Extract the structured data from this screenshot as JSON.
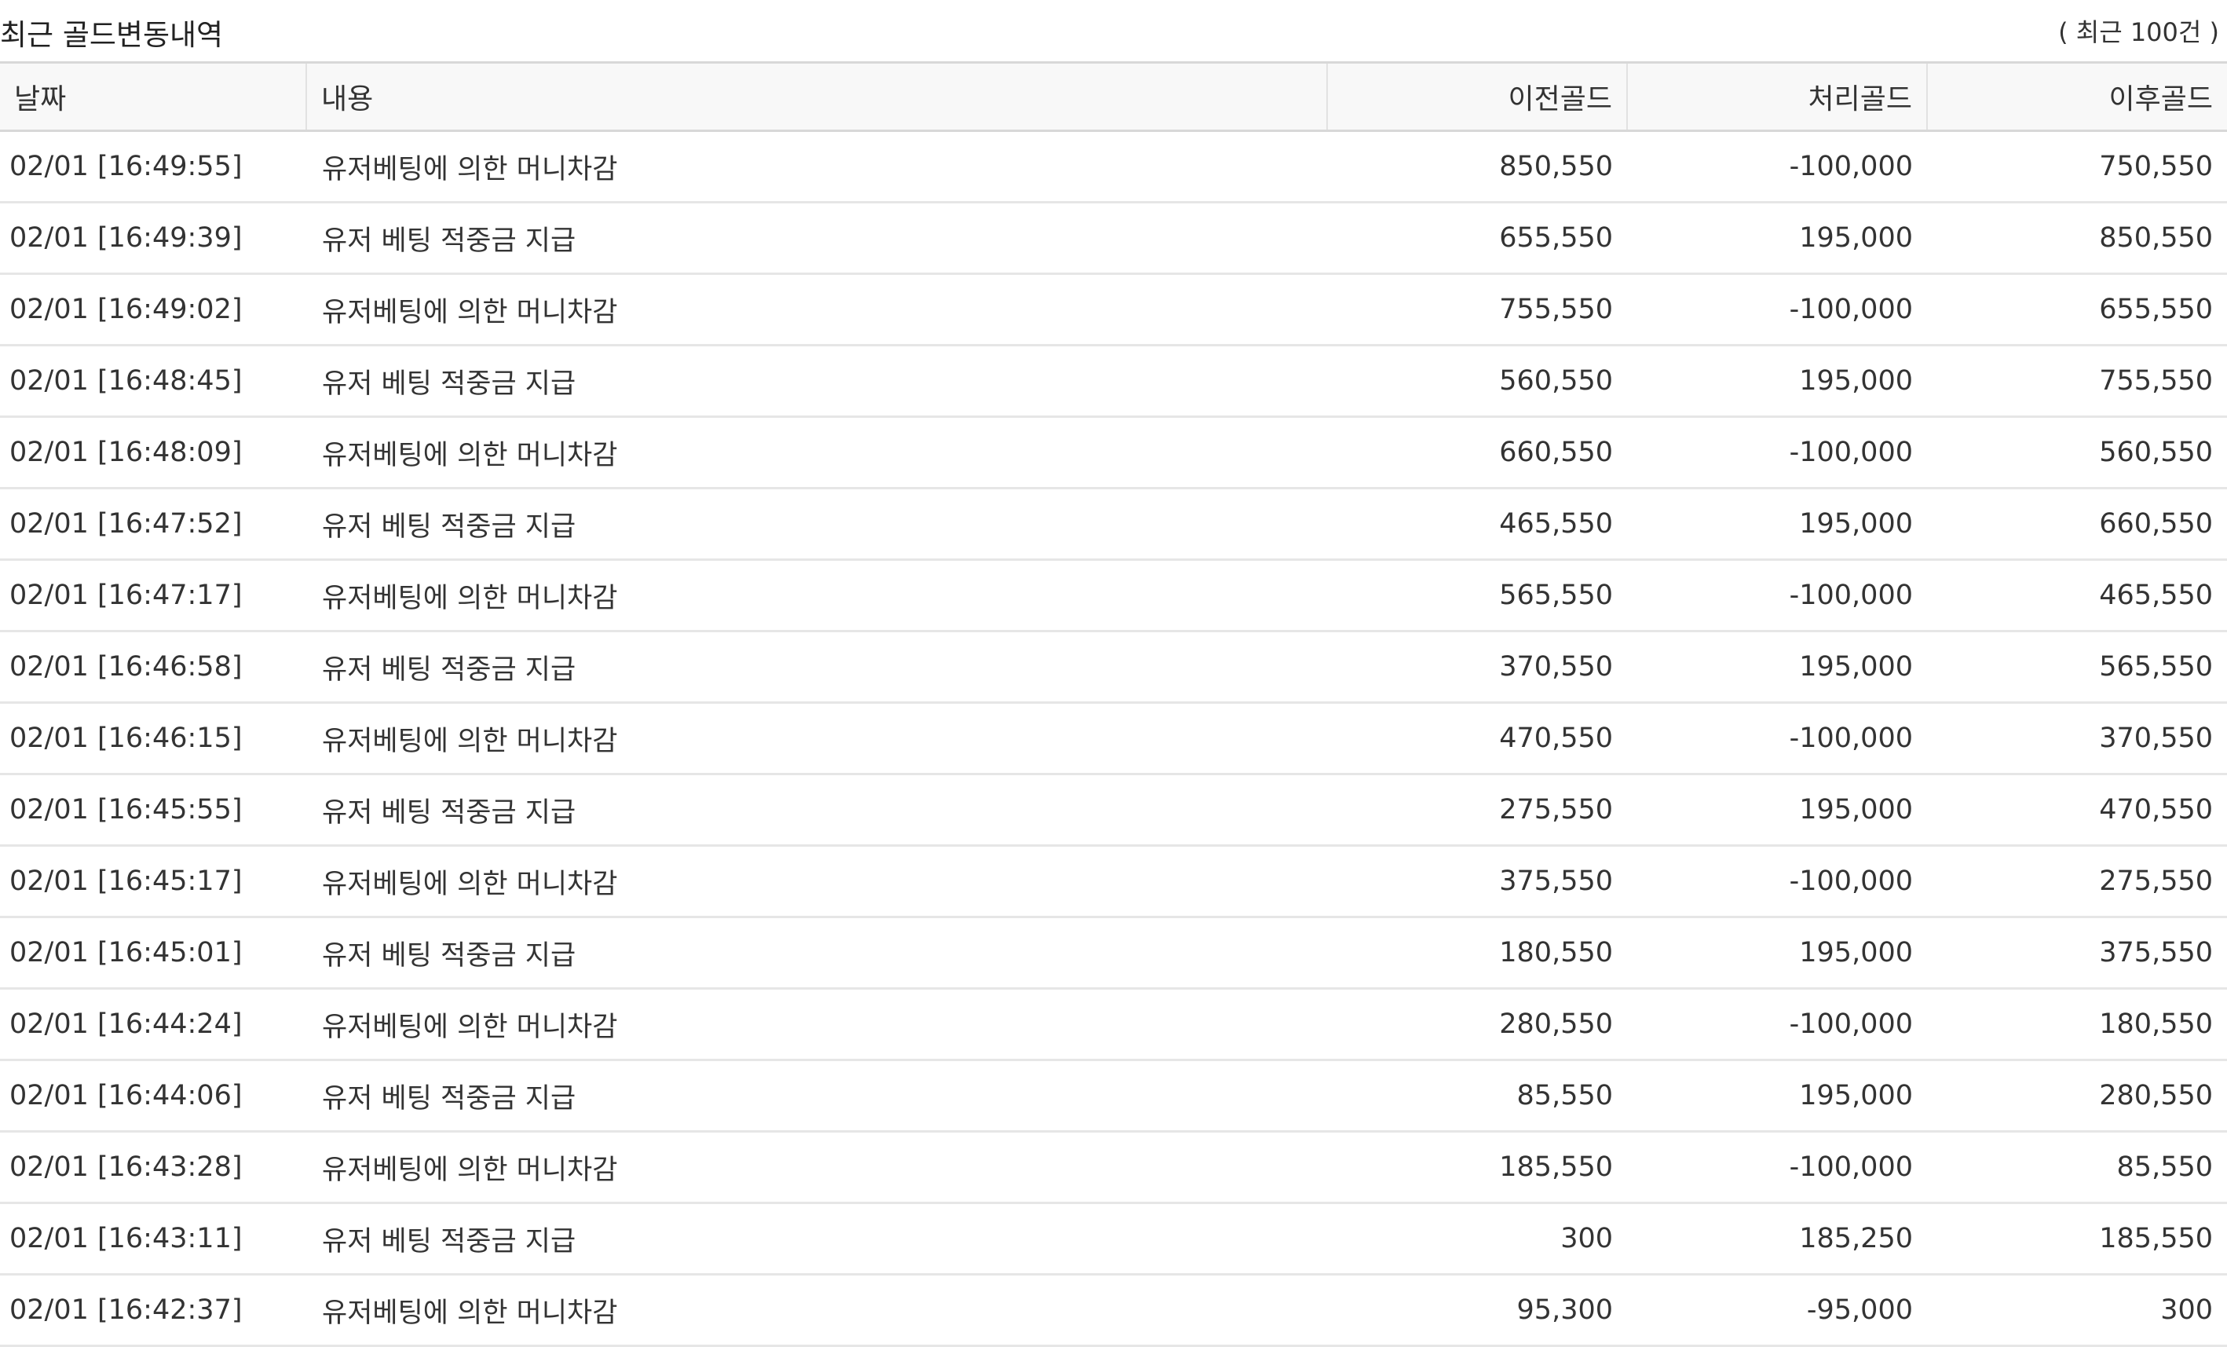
{
  "header": {
    "title": "최근 골드변동내역",
    "count_label": "( 최근 100건 )"
  },
  "table": {
    "columns": [
      "날짜",
      "내용",
      "이전골드",
      "처리골드",
      "이후골드"
    ],
    "rows": [
      {
        "date": "02/01 [16:49:55]",
        "desc": "유저베팅에 의한 머니차감",
        "prev": "850,550",
        "proc": "-100,000",
        "next": "750,550"
      },
      {
        "date": "02/01 [16:49:39]",
        "desc": "유저 베팅 적중금 지급",
        "prev": "655,550",
        "proc": "195,000",
        "next": "850,550"
      },
      {
        "date": "02/01 [16:49:02]",
        "desc": "유저베팅에 의한 머니차감",
        "prev": "755,550",
        "proc": "-100,000",
        "next": "655,550"
      },
      {
        "date": "02/01 [16:48:45]",
        "desc": "유저 베팅 적중금 지급",
        "prev": "560,550",
        "proc": "195,000",
        "next": "755,550"
      },
      {
        "date": "02/01 [16:48:09]",
        "desc": "유저베팅에 의한 머니차감",
        "prev": "660,550",
        "proc": "-100,000",
        "next": "560,550"
      },
      {
        "date": "02/01 [16:47:52]",
        "desc": "유저 베팅 적중금 지급",
        "prev": "465,550",
        "proc": "195,000",
        "next": "660,550"
      },
      {
        "date": "02/01 [16:47:17]",
        "desc": "유저베팅에 의한 머니차감",
        "prev": "565,550",
        "proc": "-100,000",
        "next": "465,550"
      },
      {
        "date": "02/01 [16:46:58]",
        "desc": "유저 베팅 적중금 지급",
        "prev": "370,550",
        "proc": "195,000",
        "next": "565,550"
      },
      {
        "date": "02/01 [16:46:15]",
        "desc": "유저베팅에 의한 머니차감",
        "prev": "470,550",
        "proc": "-100,000",
        "next": "370,550"
      },
      {
        "date": "02/01 [16:45:55]",
        "desc": "유저 베팅 적중금 지급",
        "prev": "275,550",
        "proc": "195,000",
        "next": "470,550"
      },
      {
        "date": "02/01 [16:45:17]",
        "desc": "유저베팅에 의한 머니차감",
        "prev": "375,550",
        "proc": "-100,000",
        "next": "275,550"
      },
      {
        "date": "02/01 [16:45:01]",
        "desc": "유저 베팅 적중금 지급",
        "prev": "180,550",
        "proc": "195,000",
        "next": "375,550"
      },
      {
        "date": "02/01 [16:44:24]",
        "desc": "유저베팅에 의한 머니차감",
        "prev": "280,550",
        "proc": "-100,000",
        "next": "180,550"
      },
      {
        "date": "02/01 [16:44:06]",
        "desc": "유저 베팅 적중금 지급",
        "prev": "85,550",
        "proc": "195,000",
        "next": "280,550"
      },
      {
        "date": "02/01 [16:43:28]",
        "desc": "유저베팅에 의한 머니차감",
        "prev": "185,550",
        "proc": "-100,000",
        "next": "85,550"
      },
      {
        "date": "02/01 [16:43:11]",
        "desc": "유저 베팅 적중금 지급",
        "prev": "300",
        "proc": "185,250",
        "next": "185,550"
      },
      {
        "date": "02/01 [16:42:37]",
        "desc": "유저베팅에 의한 머니차감",
        "prev": "95,300",
        "proc": "-95,000",
        "next": "300"
      }
    ]
  }
}
